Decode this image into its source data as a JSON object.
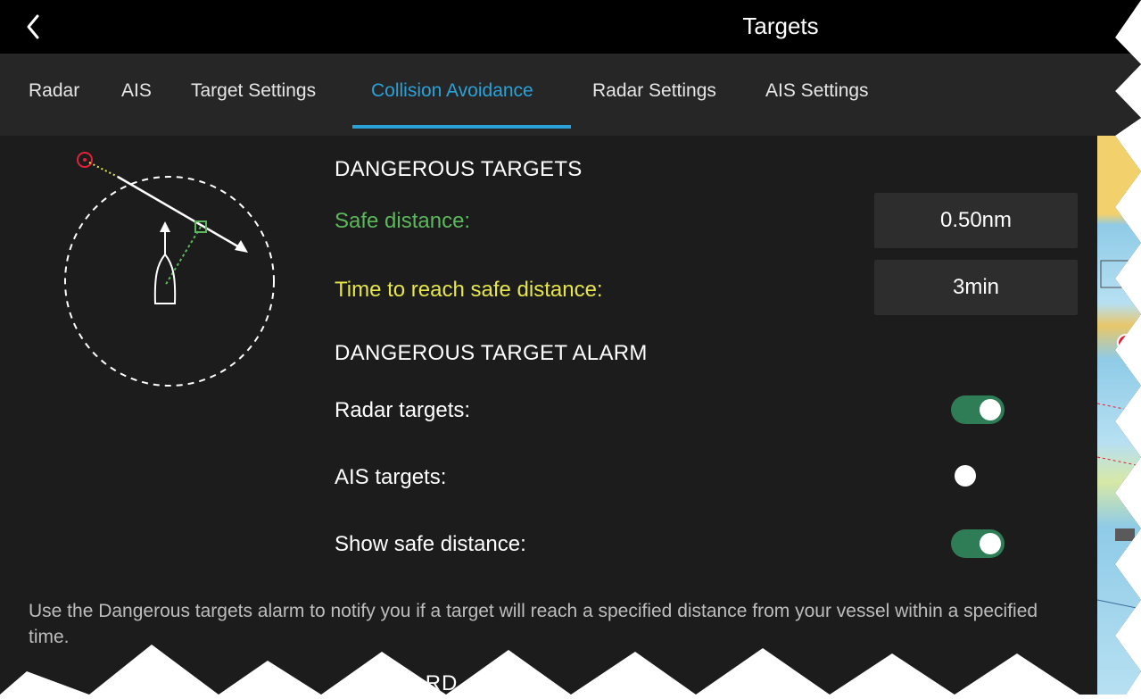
{
  "header": {
    "title": "Targets",
    "back_icon": "chevron-left-icon"
  },
  "tabs": [
    {
      "label": "Radar",
      "active": false
    },
    {
      "label": "AIS",
      "active": false
    },
    {
      "label": "Target Settings",
      "active": false
    },
    {
      "label": "Collision Avoidance",
      "active": true
    },
    {
      "label": "Radar Settings",
      "active": false
    },
    {
      "label": "AIS Settings",
      "active": false
    }
  ],
  "dangerous_targets": {
    "heading": "DANGEROUS TARGETS",
    "safe_distance": {
      "label": "Safe distance:",
      "value": "0.50nm",
      "color": "#5cb85c"
    },
    "time_to_safe": {
      "label": "Time to reach safe distance:",
      "value": "3min",
      "color": "#e6e64a"
    }
  },
  "alarm": {
    "heading": "DANGEROUS TARGET ALARM",
    "radar_targets": {
      "label": "Radar targets:",
      "on": true
    },
    "ais_targets": {
      "label": "AIS targets:",
      "on": false
    },
    "show_safe_distance": {
      "label": "Show safe distance:",
      "on": true
    }
  },
  "description": "Use the Dangerous targets alarm to notify you if a target will reach a specified distance from your vessel within a specified time.",
  "bottom_partial_heading": "DA    RD     AL A",
  "colors": {
    "accent": "#2aa1d9",
    "toggle_on": "#2e7d57",
    "target_red": "#e0223a",
    "cpa_yellow": "#e6e64a",
    "cpa_green": "#5cb85c"
  }
}
